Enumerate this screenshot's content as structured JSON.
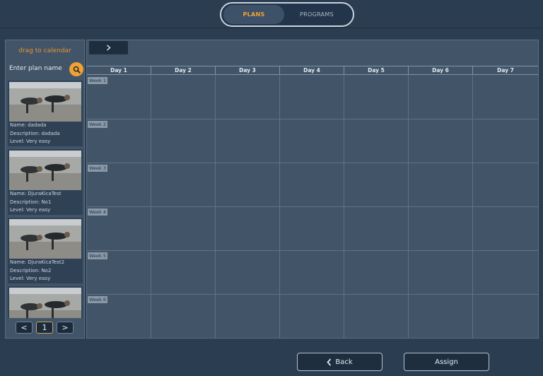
{
  "header": {
    "tabs": [
      {
        "label": "PLANS",
        "active": true
      },
      {
        "label": "PROGRAMS",
        "active": false
      }
    ],
    "accent_color": "#f2a233"
  },
  "sidebar": {
    "title": "drag to calendar",
    "search_placeholder": "Enter plan name",
    "search_icon": "search-icon",
    "plans": [
      {
        "name": "Name: dadada",
        "description": "Description: dadada",
        "level": "Level: Very easy"
      },
      {
        "name": "Name: DjuraKicaTest",
        "description": "Description: No1",
        "level": "Level: Very easy"
      },
      {
        "name": "Name: DjuraKicaTest2",
        "description": "Description: No2",
        "level": "Level: Very easy"
      },
      {
        "name": "",
        "description": "",
        "level": ""
      }
    ],
    "pager": {
      "prev": "<",
      "page": "1",
      "next": ">"
    }
  },
  "calendar": {
    "collapse_icon": "chevron-right-icon",
    "days": [
      "Day 1",
      "Day 2",
      "Day 3",
      "Day 4",
      "Day 5",
      "Day 6",
      "Day 7"
    ],
    "weeks": [
      "Week 1",
      "Week 2",
      "Week 3",
      "Week 4",
      "Week 5",
      "Week 6"
    ]
  },
  "footer": {
    "back_label": "Back",
    "assign_label": "Assign"
  }
}
